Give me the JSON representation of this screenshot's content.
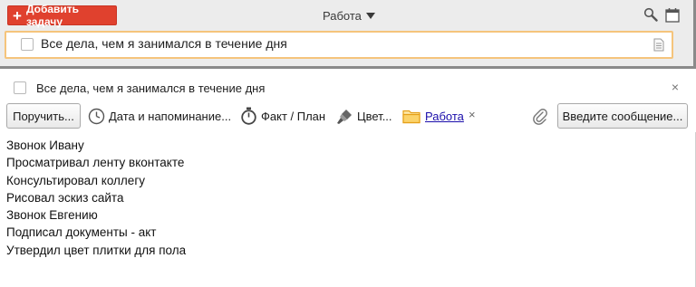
{
  "toolbar": {
    "add_task_label": "Добавить задачу",
    "list_name": "Работа"
  },
  "task_list": {
    "selected_task": "Все дела, чем я занимался в течение дня"
  },
  "detail": {
    "title": "Все дела, чем я занимался в течение дня",
    "close": "×",
    "assign_label": "Поручить...",
    "date_label": "Дата и напоминание...",
    "fact_label": "Факт / План",
    "color_label": "Цвет...",
    "folder_label": "Работа",
    "folder_remove": "×",
    "message_label": "Введите сообщение..."
  },
  "notes": [
    "Звонок Ивану",
    "Просматривал ленту вконтакте",
    "Консультировал коллегу",
    "Рисовал эскиз сайта",
    "Звонок Евгению",
    "Подписал документы - акт",
    "Утвердил цвет плитки для пола"
  ],
  "colors": {
    "accent_red": "#e0412e",
    "selection_border": "#f5c47c",
    "folder_yellow": "#f2b230",
    "link_blue": "#1a0dab"
  },
  "icons": [
    "plus-icon",
    "chevron-down-icon",
    "search-icon",
    "calendar-icon",
    "note-icon",
    "clock-icon",
    "stopwatch-icon",
    "paint-brush-icon",
    "folder-icon",
    "paperclip-icon",
    "close-icon"
  ]
}
